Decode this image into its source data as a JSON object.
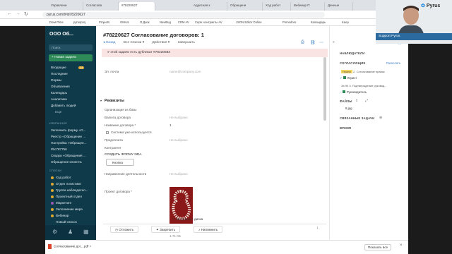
{
  "browser": {
    "tabs": [
      "Управлени",
      "Согласова",
      "#78220627",
      "Адресная к",
      "Обращени",
      "Ход работ",
      "Вебинар П",
      "Денные"
    ],
    "url": "pyrus.com/t#id78220627",
    "bookmarks": [
      "DownTime",
      "pyrusproj",
      "Projects",
      "GMAIL",
      "О.Диск",
      "NewBug",
      "CRM AV",
      "Серв. контракты AV",
      "JSON Editor Online",
      "Pomodoro",
      "Календарь",
      "Keep"
    ]
  },
  "sidebar": {
    "org_name": "ООО Об...",
    "search_placeholder": "Поиск",
    "new_task": "+ Новая задача",
    "items": [
      {
        "label": "Входящие",
        "badge": "14"
      },
      {
        "label": "Последние"
      },
      {
        "label": "Формы"
      },
      {
        "label": "Объявления"
      },
      {
        "label": "Календарь"
      },
      {
        "label": "Аналитика"
      },
      {
        "label": "Добавить людей"
      },
      {
        "label": "Еще"
      }
    ],
    "favorites_title": "ИЗБРАННОЕ",
    "favorites": [
      "Заполнить форму «О...",
      "Реестр «Обращение ...",
      "Настройка «Обращен...",
      "#bc787756",
      "Сводка «Обращения ...",
      "Обращение клиента"
    ],
    "lists_title": "СПИСКИ",
    "lists": [
      {
        "label": "Ход работ",
        "color": "#e0a830"
      },
      {
        "label": "Отдел логистики",
        "color": "#e0a830"
      },
      {
        "label": "Группа наблюдател...",
        "color": "#e0a830"
      },
      {
        "label": "Проектный отдел",
        "color": "#e0a830"
      },
      {
        "label": "Маркетинг",
        "color": "#9b59b6"
      },
      {
        "label": "Заполнение мира",
        "color": "#e0a830"
      },
      {
        "label": "Вебинар",
        "color": "#e0a830"
      },
      {
        "label": "Новый список",
        "color": ""
      }
    ]
  },
  "task": {
    "title": "#78220627 Согласование договоров: 1",
    "actions": [
      "◂ Назад",
      "Все Списки ▾",
      "Действия ▾",
      "Завершить"
    ],
    "warning": "У этой задачи есть дубликат #78220583",
    "email_label": "Эл. почта",
    "email_placeholder": "name@company.com",
    "section": "Реквизиты",
    "fields": [
      {
        "label": "Организация из базы",
        "value": ""
      },
      {
        "label": "Валюта договора",
        "value": "Не выбрано"
      },
      {
        "label": "Название договора *",
        "value": "1"
      },
      {
        "label": "Система уже используется",
        "value": ""
      },
      {
        "label": "Предоплата",
        "value": "Не выбрано"
      },
      {
        "label": "Контрагент",
        "value": ""
      }
    ],
    "nda_title": "СОЗДАТЬ ФОРМУ NDA",
    "nda_button": "Кнопка",
    "direction_label": "Направление деятельности",
    "direction_value": "Не выбрано",
    "contract_label": "Проект договора *",
    "file_name": "8.jpg",
    "file_size": "1.71 КБ",
    "upload": "Загрузить с диска",
    "bottom_buttons": [
      "Отложить",
      "Закрепить",
      "Напомнить"
    ]
  },
  "right": {
    "observers": "НАБЛЮДАТЕЛИ",
    "approvers": "СОГЛАСУЮЩИЕ",
    "approvers_action": "Разослать",
    "stage1": "2. Согласование правок",
    "stage1_tag": "Нужно",
    "approver1": "Юрист",
    "stage2": "3. Подтверждение руковод...",
    "stage2_tag": "За 90",
    "approver2": "Руководитель",
    "files": "ФАЙЛЫ",
    "file": "8.jpg",
    "related": "СВЯЗАННЫЕ ЗАДАЧИ",
    "time": "ВРЕМЯ"
  },
  "webcam": {
    "brand": "Pyrus",
    "label": "Support Pyrus"
  },
  "downloads": {
    "file": "Согласование дог....pdf",
    "show_all": "Показать все"
  }
}
